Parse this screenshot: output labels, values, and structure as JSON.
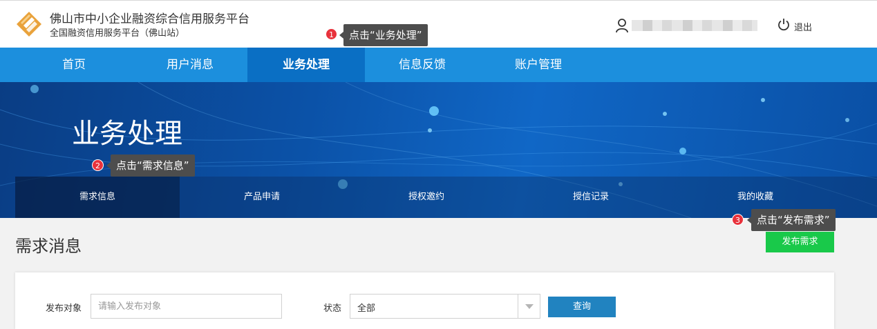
{
  "header": {
    "site_title": "佛山市中小企业融资综合信用服务平台",
    "site_subtitle": "全国融资信用服务平台（佛山站）",
    "logout_label": "退出"
  },
  "nav": {
    "items": [
      {
        "label": "首页"
      },
      {
        "label": "用户消息"
      },
      {
        "label": "业务处理"
      },
      {
        "label": "信息反馈"
      },
      {
        "label": "账户管理"
      }
    ]
  },
  "banner": {
    "title": "业务处理",
    "subnav": [
      {
        "label": "需求信息"
      },
      {
        "label": "产品申请"
      },
      {
        "label": "授权邀约"
      },
      {
        "label": "授信记录"
      },
      {
        "label": "我的收藏"
      }
    ]
  },
  "tooltips": [
    {
      "number": "1",
      "text": "点击“业务处理”"
    },
    {
      "number": "2",
      "text": "点击“需求信息”"
    },
    {
      "number": "3",
      "text": "点击“发布需求”"
    }
  ],
  "content": {
    "heading": "需求消息",
    "publish_button": "发布需求",
    "filter": {
      "target_label": "发布对象",
      "target_placeholder": "请输入发布对象",
      "status_label": "状态",
      "status_value": "全部",
      "query_button": "查询"
    }
  },
  "colors": {
    "nav_bg": "#1c8fdd",
    "nav_active": "#0a6fc4",
    "publish_green": "#19c94a",
    "query_blue": "#2183c0",
    "badge_red": "#e8323c"
  }
}
